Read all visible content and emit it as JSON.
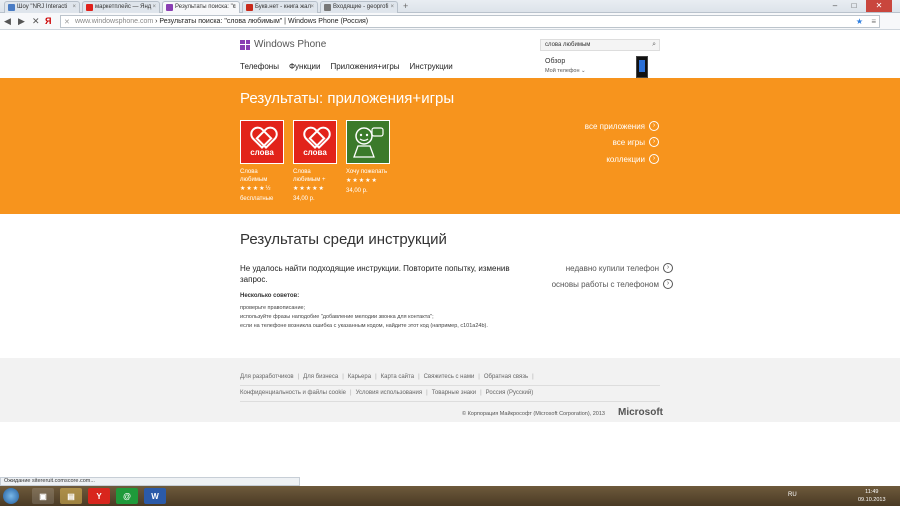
{
  "browser": {
    "tabs": [
      {
        "label": "Шоу \"NRJ Interacti",
        "color": "#4a7cc4"
      },
      {
        "label": "маркетплейс — Янд",
        "color": "#e0201b"
      },
      {
        "label": "Результаты поиска: \"с",
        "color": "#8a3fb3"
      },
      {
        "label": "Букв.нет - книга жал",
        "color": "#c8291b"
      },
      {
        "label": "Входящие - geoprofi",
        "color": "#777777"
      }
    ],
    "close_glyph": "×",
    "new_tab": "+",
    "window_controls": {
      "minimize": "–",
      "maximize": "□",
      "close": "✕"
    },
    "nav": {
      "back": "◀",
      "forward": "▶",
      "reload": "✕",
      "home": "Я"
    },
    "url_domain": "www.windowsphone.com",
    "url_rest": " › Результаты поиска: \"слова любимым\" | Windows Phone (Россия)"
  },
  "header": {
    "logo": "Windows Phone",
    "search_value": "слова любимым",
    "nav": [
      "Телефоны",
      "Функции",
      "Приложения+игры",
      "Инструкции"
    ],
    "overview": "Обзор",
    "my_phone": "Мой телефон ⌄"
  },
  "apps_section": {
    "title": "Результаты: приложения+игры",
    "apps": [
      {
        "name_line1": "Слова",
        "name_line2": "любимым",
        "stars": "★★★★½",
        "rating": 4.5,
        "price": "бесплатные",
        "tile_word": "слова"
      },
      {
        "name_line1": "Слова",
        "name_line2": "любимым +",
        "stars": "★★★★★",
        "rating": 5,
        "price": "34,00 р.",
        "tile_word": "слова"
      },
      {
        "name_line1": "Хочу пожелать",
        "name_line2": "",
        "stars": "★★★★★",
        "rating": 5,
        "price": "34,00 р.",
        "tile_word": ""
      }
    ],
    "links": [
      "все приложения",
      "все игры",
      "коллекции"
    ]
  },
  "instructions": {
    "title": "Результаты среди инструкций",
    "message": "Не удалось найти подходящие инструкции. Повторите попытку, изменив запрос.",
    "tips_title": "Несколько советов:",
    "tips": [
      "проверьте правописание;",
      "используйте фразы наподобие \"добавление мелодии звонка для контакта\";",
      "если на телефоне возникла ошибка с указанным кодом, найдите этот код (например, c101a24b)."
    ],
    "links": [
      "недавно купили телефон",
      "основы работы с телефоном"
    ]
  },
  "footer": {
    "row1": [
      "Для разработчиков",
      "Для бизнеса",
      "Карьера",
      "Карта сайта",
      "Свяжитесь с нами",
      "Обратная связь"
    ],
    "row2": [
      "Конфиденциальность и файлы cookie",
      "Условия использования",
      "Товарные знаки",
      "Россия (Русский)"
    ],
    "copyright": "© Корпорация Майкрософт (Microsoft Corporation), 2013",
    "ms_logo": "Microsoft"
  },
  "status_text": "Ожидание sitereruit.comscore.com...",
  "taskbar": {
    "lang": "RU",
    "time": "11:49",
    "date": "09.10.2013"
  },
  "colors": {
    "accent_orange": "#f7941d",
    "wp_purple": "#8a3fb3"
  }
}
